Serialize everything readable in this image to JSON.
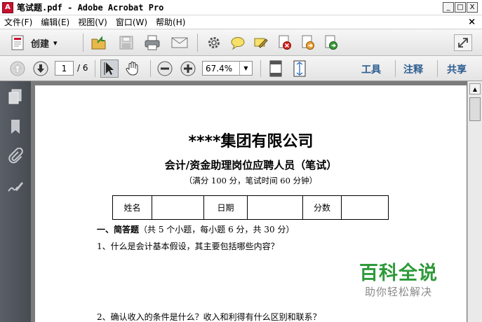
{
  "window": {
    "title": "笔试题.pdf - Adobe Acrobat Pro",
    "app_icon_label": "A",
    "minimize_glyph": "_",
    "maximize_glyph": "□",
    "close_glyph": "X"
  },
  "menu": {
    "items": [
      {
        "label": "文件(F)"
      },
      {
        "label": "编辑(E)"
      },
      {
        "label": "视图(V)"
      },
      {
        "label": "窗口(W)"
      },
      {
        "label": "帮助(H)"
      }
    ],
    "doc_close_glyph": "×"
  },
  "toolbar1": {
    "create_label": "创建",
    "create_caret": "▾"
  },
  "toolbar2": {
    "current_page": "1",
    "page_count": "/ 6",
    "zoom": "67.4%",
    "zoom_caret": "▼",
    "links": [
      "工具",
      "注释",
      "共享"
    ]
  },
  "scroll": {
    "up_glyph": "▲",
    "down_glyph": "▼"
  },
  "document": {
    "title": "****集团有限公司",
    "subtitle": "会计/资金助理岗位应聘人员（笔试）",
    "note": "（满分 100 分，笔试时间 60 分钟）",
    "table": {
      "name_label": "姓名",
      "date_label": "日期",
      "score_label": "分数"
    },
    "section_title": "一、简答题",
    "section_note": "（共 5 个小题，每小题 6 分，共 30 分）",
    "question1": "1、什么是会计基本假设，其主要包括哪些内容？",
    "question2": "2、确认收入的条件是什么？收入和利得有什么区别和联系？"
  },
  "watermark": {
    "main": "百科全说",
    "sub": "助你轻松解决"
  },
  "colors": {
    "watermark_green": "#2e9a3a",
    "pane_link_blue": "#2c5d90",
    "nav_panel": "#4d5158"
  }
}
